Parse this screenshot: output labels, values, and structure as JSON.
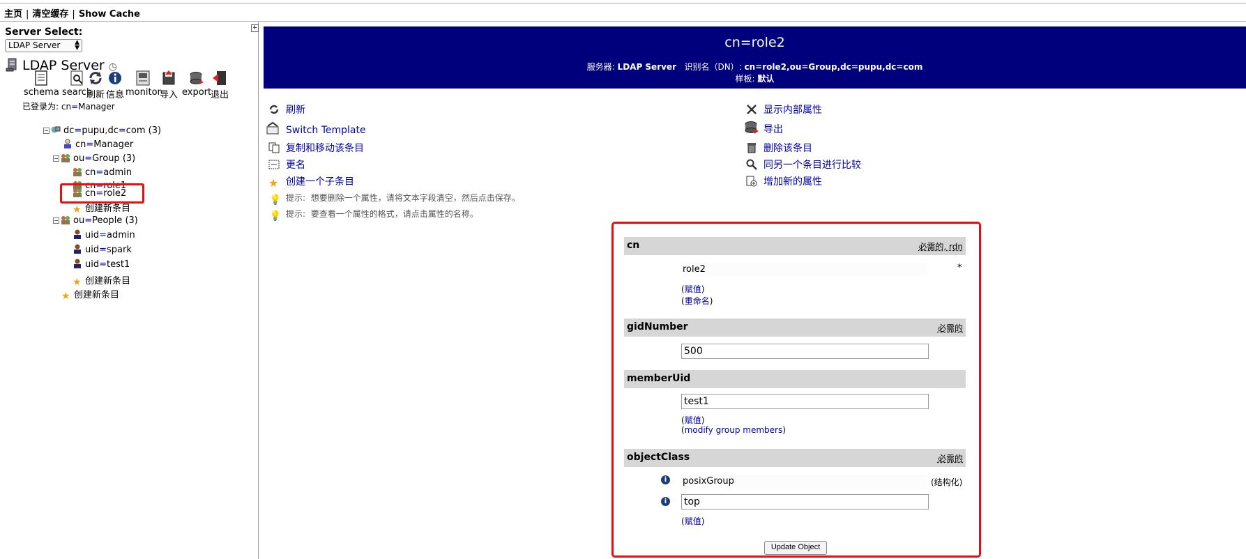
{
  "topbar": {
    "home": "主页",
    "clear_cache": "清空缓存",
    "show_cache": "Show Cache",
    "separator": "|"
  },
  "left": {
    "server_select_label": "Server Select:",
    "server_select_value": "LDAP Server",
    "server_title": "LDAP Server",
    "server_title_icon": "clock-icon",
    "toolbar": [
      {
        "label": "schema",
        "icon": "schema-icon"
      },
      {
        "label": "search",
        "icon": "search-icon"
      },
      {
        "label": "刷新",
        "icon": "refresh-icon"
      },
      {
        "label": "信息",
        "icon": "info-icon"
      },
      {
        "label": "monitor",
        "icon": "monitor-icon"
      },
      {
        "label": "导入",
        "icon": "import-icon"
      },
      {
        "label": "export",
        "icon": "export-icon"
      },
      {
        "label": "退出",
        "icon": "logout-icon"
      }
    ],
    "logged_in_prefix": "已登录为:",
    "logged_in_user_key": "cn",
    "logged_in_user_val": "Manager",
    "tree": [
      {
        "key": "dc",
        "val": "pupu",
        "sep": ",",
        "key2": "dc",
        "val2": "com",
        "count": "(3)"
      },
      {
        "key": "cn",
        "val": "Manager"
      },
      {
        "key": "ou",
        "val": "Group",
        "count": "(3)"
      },
      {
        "key": "cn",
        "val": "admin"
      },
      {
        "key": "cn",
        "val": "role1"
      },
      {
        "key": "cn",
        "val": "role2"
      },
      {
        "label": "创建新条目"
      },
      {
        "key": "ou",
        "val": "People",
        "count": "(3)"
      },
      {
        "key": "uid",
        "val": "admin"
      },
      {
        "key": "uid",
        "val": "spark"
      },
      {
        "key": "uid",
        "val": "test1"
      },
      {
        "label": "创建新条目"
      },
      {
        "label": "创建新条目"
      }
    ]
  },
  "header": {
    "title": "cn=role2",
    "server_label": "服务器:",
    "server_value": "LDAP Server",
    "dn_label": "识别名（DN）:",
    "dn_value": "cn=role2,ou=Group,dc=pupu,dc=com",
    "template_label": "样板:",
    "template_value": "默认"
  },
  "actions_left": [
    {
      "label": "刷新",
      "icon": "refresh-icon"
    },
    {
      "label": "Switch Template",
      "icon": "switch-template-icon"
    },
    {
      "label": "复制和移动该条目",
      "icon": "copy-icon"
    },
    {
      "label": "更名",
      "icon": "rename-icon"
    },
    {
      "label": "创建一个子条目",
      "icon": "star-icon"
    }
  ],
  "actions_right": [
    {
      "label": "显示内部属性",
      "icon": "tools-icon"
    },
    {
      "label": "导出",
      "icon": "export-icon"
    },
    {
      "label": "删除该条目",
      "icon": "trash-icon"
    },
    {
      "label": "同另一个条目进行比较",
      "icon": "compare-icon"
    },
    {
      "label": "增加新的属性",
      "icon": "add-attribute-icon"
    }
  ],
  "hints": [
    {
      "prefix": "提示:",
      "text": "想要删除一个属性，请将文本字段清空，然后点击保存。"
    },
    {
      "prefix": "提示:",
      "text": "要查看一个属性的格式，请点击属性的名称。"
    }
  ],
  "form": {
    "cn": {
      "name": "cn",
      "req": "必需的, rdn",
      "value": "role2",
      "star": "*",
      "link1": "赋值",
      "link2": "重命名"
    },
    "gidNumber": {
      "name": "gidNumber",
      "req": "必需的",
      "value": "500"
    },
    "memberUid": {
      "name": "memberUid",
      "value": "test1",
      "link1": "赋值",
      "link2": "modify group members"
    },
    "objectClass": {
      "name": "objectClass",
      "req": "必需的",
      "value1": "posixGroup",
      "value1_note": "(结构化)",
      "value2": "top",
      "link1": "赋值"
    },
    "update_button": "Update Object"
  },
  "colors": {
    "header_bg": "#00007d",
    "highlight": "#e21010",
    "link": "#0000aa",
    "attr_head_bg": "#d6d6d6"
  }
}
